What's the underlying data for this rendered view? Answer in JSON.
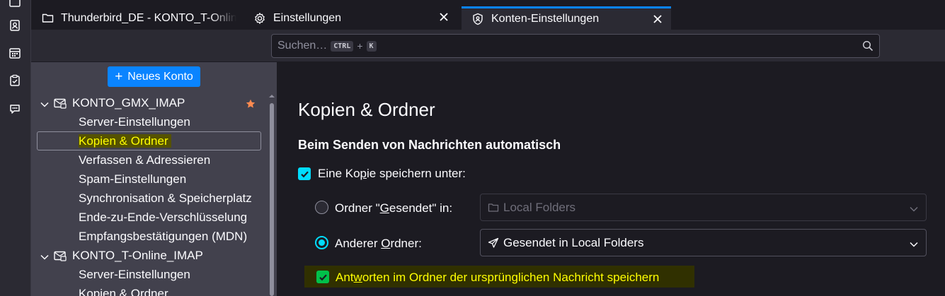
{
  "tabs": [
    {
      "label": "Thunderbird_DE - KONTO_T-Online_IMAP",
      "icon": "folder-icon",
      "active": false
    },
    {
      "label": "Einstellungen",
      "icon": "gear-icon",
      "active": false
    },
    {
      "label": "Konten-Einstellungen",
      "icon": "account-settings-icon",
      "active": true
    }
  ],
  "search": {
    "placeholder": "Suchen…",
    "shortcut_mod": "CTRL",
    "shortcut_plus": "+",
    "shortcut_key": "K"
  },
  "sidebar": {
    "new_account_label": "Neues Konto",
    "accounts": [
      {
        "name": "KONTO_GMX_IMAP",
        "default_star": true,
        "items": [
          "Server-Einstellungen",
          "Kopien & Ordner",
          "Verfassen & Adressieren",
          "Spam-Einstellungen",
          "Synchronisation & Speicherplatz",
          "Ende-zu-Ende-Verschlüsselung",
          "Empfangsbestätigungen (MDN)"
        ]
      },
      {
        "name": "KONTO_T-Online_IMAP",
        "default_star": false,
        "items": [
          "Server-Einstellungen",
          "Kopien & Ordner"
        ]
      }
    ],
    "selected_item": "Kopien & Ordner"
  },
  "content": {
    "title": "Kopien & Ordner",
    "section_heading": "Beim Senden von Nachrichten automatisch",
    "save_copy": {
      "pre": "Eine Ko",
      "access": "p",
      "post": "ie speichern unter:",
      "checked": true
    },
    "sent_folder": {
      "pre": "Ordner \"",
      "access": "G",
      "post": "esendet\" in:",
      "select_value": "Local Folders",
      "checked": false
    },
    "other_folder": {
      "pre": "Anderer ",
      "access": "O",
      "post": "rdner:",
      "select_value": "Gesendet in Local Folders",
      "checked": true
    },
    "reply_in_folder": {
      "pre": "Ant",
      "access": "w",
      "post": "orten im Ordner der ursprünglichen Nachricht speichern",
      "checked": true
    }
  },
  "colors": {
    "accent": "#0a84ff",
    "checkbox": "#00ddff",
    "highlight_text": "#ffff00",
    "default_star": "#ff8a50"
  }
}
